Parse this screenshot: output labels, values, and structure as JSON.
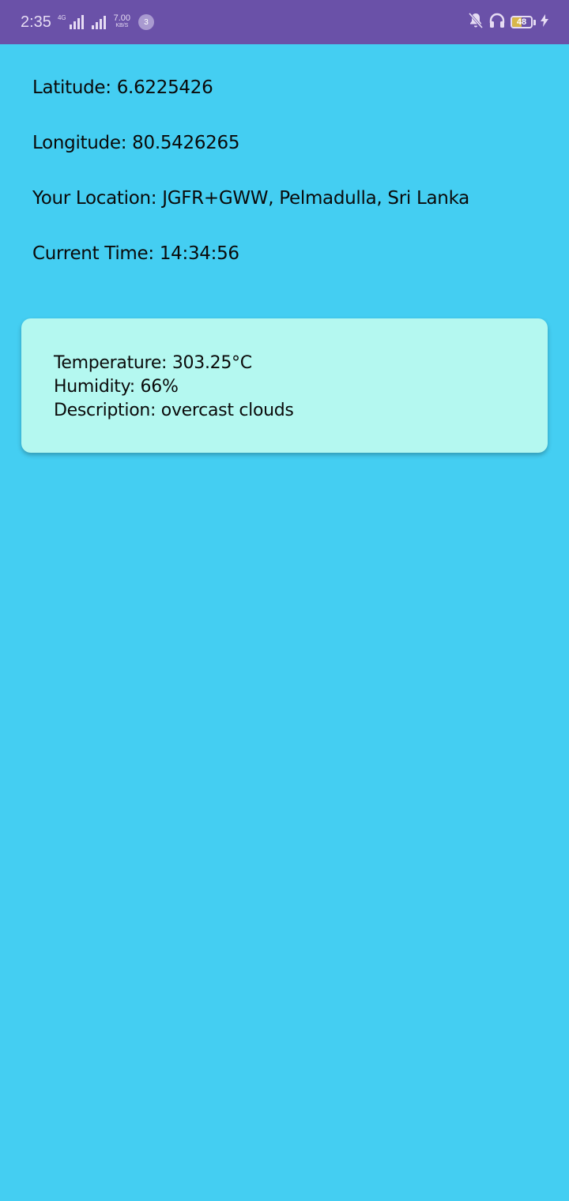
{
  "status_bar": {
    "time": "2:35",
    "network_label": "4G",
    "speed_value": "7.00",
    "speed_unit": "KB/S",
    "notification_count": "3",
    "battery_level": "48",
    "battery_fraction": 0.48,
    "icons": [
      "signal-bars-icon",
      "signal-bars-icon",
      "mute-notifications-icon",
      "headphones-icon",
      "battery-icon",
      "charging-bolt-icon"
    ]
  },
  "location": {
    "latitude_label": "Latitude: 6.6225426",
    "longitude_label": "Longitude: 80.5426265",
    "place_label": "Your Location: JGFR+GWW, Pelmadulla, Sri Lanka",
    "time_label": "Current Time: 14:34:56"
  },
  "weather": {
    "temperature_label": "Temperature: 303.25°C",
    "humidity_label": "Humidity: 66%",
    "description_label": "Description: overcast clouds"
  },
  "colors": {
    "status_bar": "#6a51a8",
    "background": "#44cef2",
    "card": "#b4f8f0",
    "battery_fill": "#d8b74a"
  }
}
